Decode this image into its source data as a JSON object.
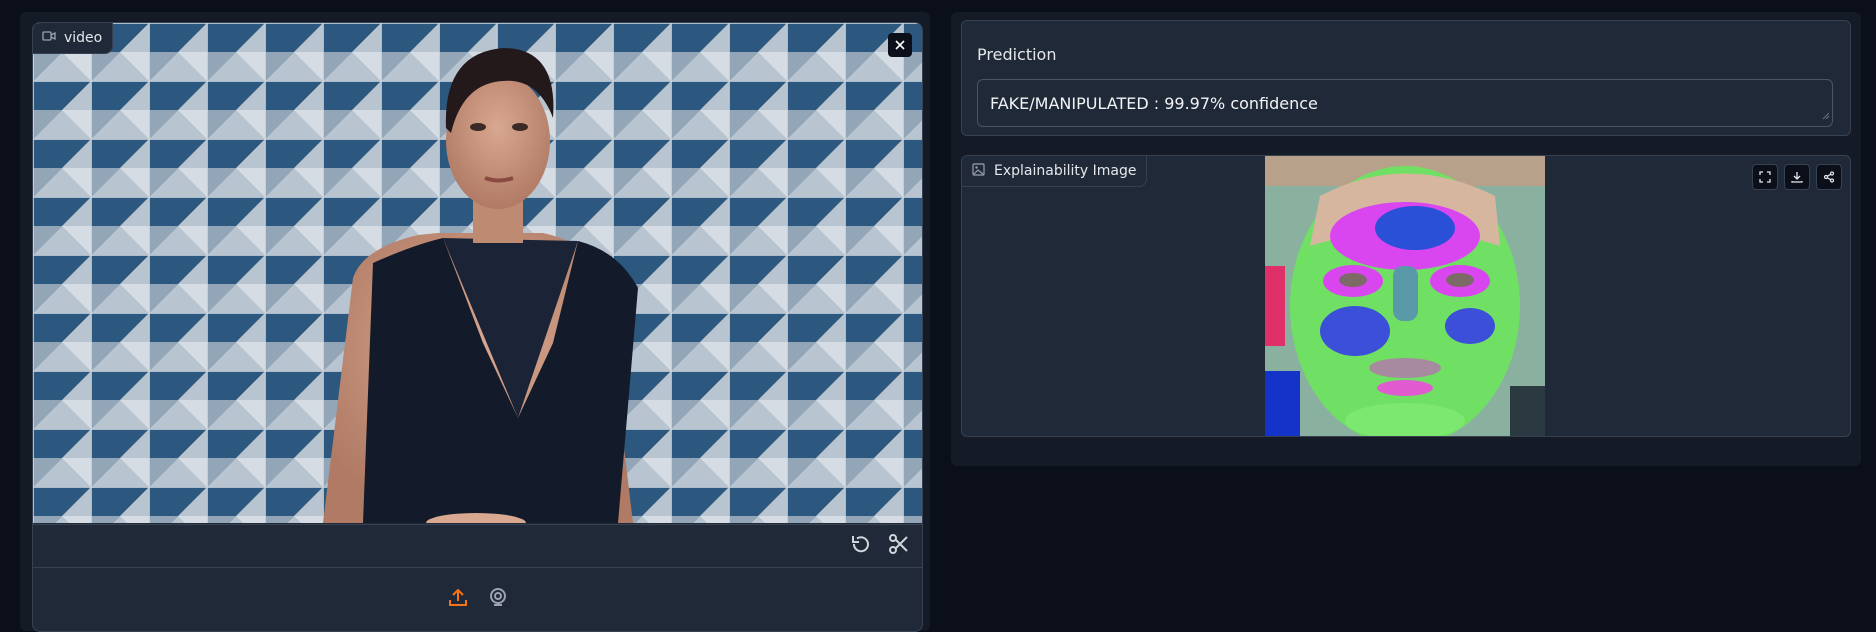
{
  "video_input": {
    "label": "video",
    "label_icon": "video-camera-icon",
    "close_icon": "close-icon",
    "trim_controls": [
      {
        "name": "undo-button",
        "icon": "undo-icon"
      },
      {
        "name": "trim-button",
        "icon": "scissors-icon"
      }
    ],
    "source_controls": [
      {
        "name": "upload-button",
        "icon": "upload-icon",
        "color": "#f97316"
      },
      {
        "name": "webcam-button",
        "icon": "webcam-icon",
        "color": "#9ca3af"
      }
    ]
  },
  "prediction": {
    "label": "Prediction",
    "value": "FAKE/MANIPULATED : 99.97% confidence"
  },
  "explainability": {
    "label": "Explainability Image",
    "label_icon": "image-icon",
    "tools": [
      {
        "name": "fullscreen-button",
        "icon": "fullscreen-icon"
      },
      {
        "name": "download-button",
        "icon": "download-icon"
      },
      {
        "name": "share-button",
        "icon": "share-icon"
      }
    ]
  },
  "colors": {
    "background": "#0b0f19",
    "panel": "#1f2937",
    "border": "#374151",
    "accent": "#f97316"
  }
}
